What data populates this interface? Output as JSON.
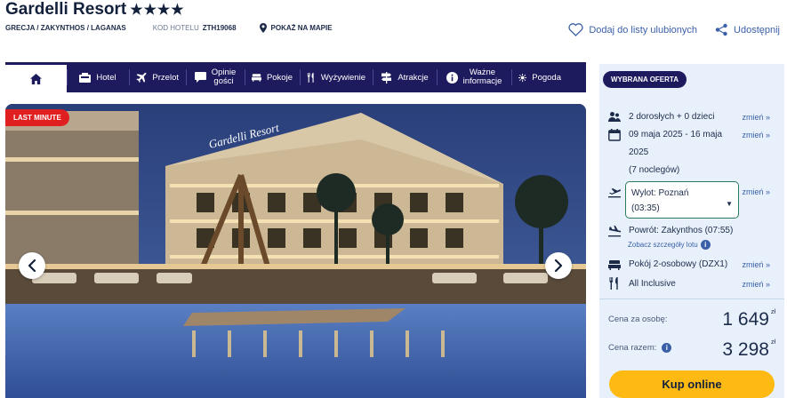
{
  "hotel": {
    "name": "Gardelli Resort",
    "stars": "★★★★",
    "location": "GRECJA / ZAKYNTHOS / LAGANAS",
    "code_label": "KOD HOTELU",
    "code": "ZTH19068",
    "map_link": "POKAŻ NA MAPIE"
  },
  "header_actions": {
    "favorite": "Dodaj do listy ulubionych",
    "share": "Udostępnij"
  },
  "tabs": [
    {
      "label": "",
      "icon": "home-icon"
    },
    {
      "label": "Hotel",
      "icon": "hotel-icon"
    },
    {
      "label": "Przelot",
      "icon": "plane-icon"
    },
    {
      "label": "Opinie gości",
      "line1": "Opinie",
      "line2": "gości",
      "icon": "speech-bubble-icon"
    },
    {
      "label": "Pokoje",
      "icon": "bed-icon"
    },
    {
      "label": "Wyżywienie",
      "icon": "cutlery-icon"
    },
    {
      "label": "Atrakcje",
      "icon": "signpost-icon"
    },
    {
      "label": "Ważne informacje",
      "line1": "Ważne",
      "line2": "informacje",
      "icon": "info-icon"
    },
    {
      "label": "Pogoda",
      "icon": "sun-icon"
    }
  ],
  "hero": {
    "badge": "LAST MINUTE",
    "sign_text": "Gardelli Resort"
  },
  "offer": {
    "badge": "WYBRANA OFERTA",
    "change_label": "zmień »",
    "travelers": "2 dorosłych + 0 dzieci",
    "dates_line1": "09 maja 2025 - 16 maja",
    "dates_line2": "2025",
    "nights": "(7 noclegów)",
    "departure_line1": "Wylot: Poznań",
    "departure_line2": "(03:35)",
    "return": "Powrót: Zakynthos (07:55)",
    "flight_details": "Zobacz szczegóły lotu",
    "room": "Pokój 2-osobowy (DZX1)",
    "board": "All Inclusive",
    "price_per_person_label": "Cena za osobę:",
    "price_per_person": "1 649",
    "price_total_label": "Cena razem:",
    "price_total": "3 298",
    "currency": "zł",
    "buy_button": "Kup online"
  },
  "colors": {
    "navy": "#1e1a5e",
    "link": "#3a5fa8",
    "badge_red": "#e02020",
    "buy_yellow": "#ffb913",
    "panel_bg": "#e8f1fb"
  }
}
